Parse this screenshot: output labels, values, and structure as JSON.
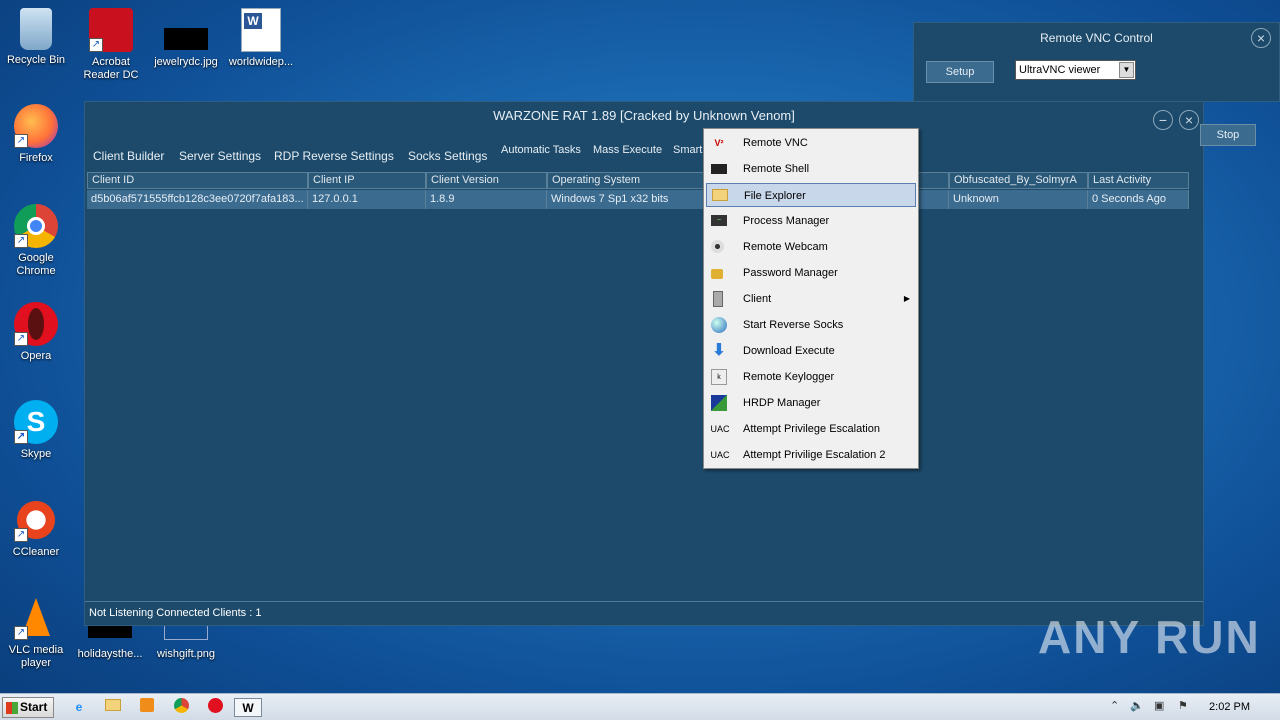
{
  "desktop": {
    "icons": [
      {
        "label": "Recycle Bin"
      },
      {
        "label": "Acrobat Reader DC"
      },
      {
        "label": "jewelrydc.jpg"
      },
      {
        "label": "worldwidep..."
      },
      {
        "label": "Firefox"
      },
      {
        "label": "Google Chrome"
      },
      {
        "label": "Opera"
      },
      {
        "label": "Skype"
      },
      {
        "label": "CCleaner"
      },
      {
        "label": "VLC media player"
      },
      {
        "label": "holidaysthe..."
      },
      {
        "label": "wishgift.png"
      }
    ]
  },
  "rat": {
    "title": "WARZONE RAT 1.89 [Cracked by Unknown Venom]",
    "menu": {
      "client_builder": "Client Builder",
      "server_settings": "Server Settings",
      "rdp_reverse": "RDP Reverse Settings",
      "socks": "Socks Settings",
      "auto_tasks": "Automatic Tasks",
      "mass_execute": "Mass Execute",
      "smart": "Smart"
    },
    "columns": [
      "Client ID",
      "Client IP",
      "Client Version",
      "Operating System",
      "Obfuscated_By_SolmyrA",
      "Last Activity"
    ],
    "row": {
      "client_id": "d5b06af571555ffcb128c3ee0720f7afa183...",
      "client_ip": "127.0.0.1",
      "version": "1.8.9",
      "os": "Windows 7 Sp1 x32 bits",
      "obfuscated": "Unknown",
      "last_activity": "0 Seconds Ago"
    },
    "status": "Not Listening   Connected Clients : 1"
  },
  "vnc": {
    "title": "Remote VNC Control",
    "setup": "Setup",
    "viewer": "UltraVNC viewer",
    "stop": "Stop"
  },
  "context_menu": {
    "items": [
      {
        "label": "Remote VNC",
        "icon": "vnc-icon"
      },
      {
        "label": "Remote Shell",
        "icon": "shell-icon"
      },
      {
        "label": "File Explorer",
        "icon": "folder-icon"
      },
      {
        "label": "Process Manager",
        "icon": "process-icon"
      },
      {
        "label": "Remote Webcam",
        "icon": "webcam-icon"
      },
      {
        "label": "Password Manager",
        "icon": "lock-icon"
      },
      {
        "label": "Client",
        "icon": "client-icon"
      },
      {
        "label": "Start Reverse Socks",
        "icon": "globe-icon"
      },
      {
        "label": "Download  Execute",
        "icon": "download-icon"
      },
      {
        "label": "Remote Keylogger",
        "icon": "keylogger-icon"
      },
      {
        "label": "HRDP Manager",
        "icon": "rdp-icon"
      },
      {
        "label": "Attempt Privilege Escalation",
        "icon": "uac-icon"
      },
      {
        "label": "Attempt Privilige Escalation 2",
        "icon": "uac-icon"
      }
    ],
    "uac_text": "UAC"
  },
  "taskbar": {
    "start": "Start",
    "clock": "2:02 PM"
  },
  "watermark": "ANY RUN"
}
